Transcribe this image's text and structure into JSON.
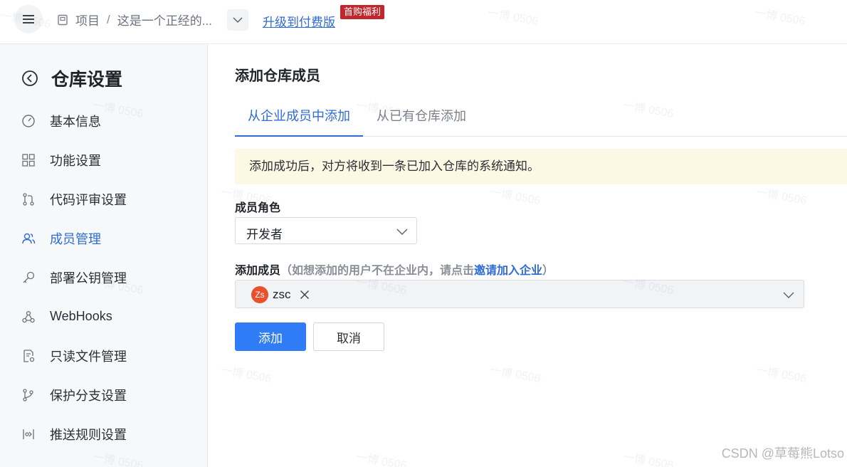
{
  "topbar": {
    "breadcrumb_project": "项目",
    "breadcrumb_separator": "/",
    "breadcrumb_repo": "这是一个正经的...",
    "upgrade_link": "升级到付费版",
    "promo_badge": "首购福利"
  },
  "sidebar": {
    "title": "仓库设置",
    "items": [
      {
        "label": "基本信息",
        "icon": "gauge-icon",
        "active": false
      },
      {
        "label": "功能设置",
        "icon": "grid-icon",
        "active": false
      },
      {
        "label": "代码评审设置",
        "icon": "pull-request-icon",
        "active": false
      },
      {
        "label": "成员管理",
        "icon": "users-icon",
        "active": true
      },
      {
        "label": "部署公钥管理",
        "icon": "key-icon",
        "active": false
      },
      {
        "label": "WebHooks",
        "icon": "webhook-icon",
        "active": false
      },
      {
        "label": "只读文件管理",
        "icon": "file-settings-icon",
        "active": false
      },
      {
        "label": "保护分支设置",
        "icon": "branch-icon",
        "active": false
      },
      {
        "label": "推送规则设置",
        "icon": "push-rule-icon",
        "active": false
      }
    ]
  },
  "main": {
    "title": "添加仓库成员",
    "tabs": [
      {
        "label": "从企业成员中添加",
        "active": true
      },
      {
        "label": "从已有仓库添加",
        "active": false
      }
    ],
    "notice": "添加成功后，对方将收到一条已加入仓库的系统通知。",
    "role_label": "成员角色",
    "role_value": "开发者",
    "member_label": "添加成员",
    "member_hint_prefix": "（如想添加的用户不在企业内，请点击",
    "member_hint_link": "邀请加入企业",
    "member_hint_suffix": "）",
    "selected_members": [
      {
        "initials": "Zs",
        "name": "zsc"
      }
    ],
    "add_button": "添加",
    "cancel_button": "取消"
  },
  "watermark": {
    "text": "一博 0506",
    "csdn": "CSDN @草莓熊Lotso"
  },
  "colors": {
    "accent": "#2f6bd6",
    "primary_button": "#2f7cf6",
    "notice_bg": "#fdf8e4",
    "promo_badge": "#c0272d",
    "avatar": "#e8502e"
  }
}
